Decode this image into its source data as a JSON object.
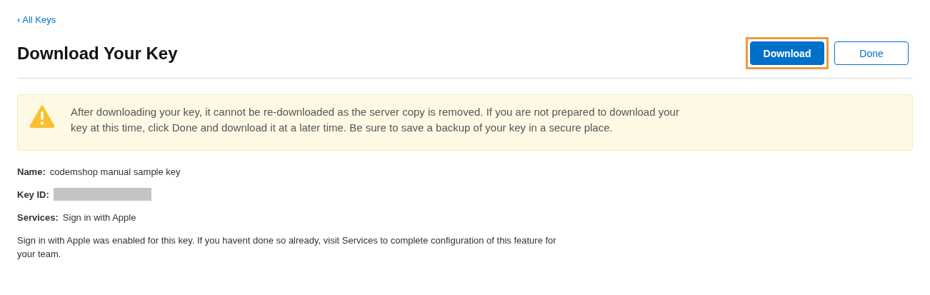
{
  "back_link": {
    "label": "‹ All Keys"
  },
  "title": "Download Your Key",
  "buttons": [
    {
      "label": "Download",
      "kind": "primary",
      "highlighted": true
    },
    {
      "label": "Done",
      "kind": "secondary",
      "highlighted": false
    }
  ],
  "alert": {
    "kind": "warning",
    "text": "After downloading your key, it cannot be re-downloaded as the server copy is removed. If you are not prepared to download your key at this time, click Done and download it at a later time. Be sure to save a backup of your key in a secure place."
  },
  "details": [
    {
      "label": "Name:",
      "value": "codemshop manual sample key",
      "redacted": false
    },
    {
      "label": "Key ID:",
      "redacted": true
    },
    {
      "label": "Services:",
      "value": "Sign in with Apple",
      "redacted": false
    }
  ],
  "note": "Sign in with Apple was enabled for this key. If you havent done so already, visit Services to complete configuration of this feature for your team."
}
